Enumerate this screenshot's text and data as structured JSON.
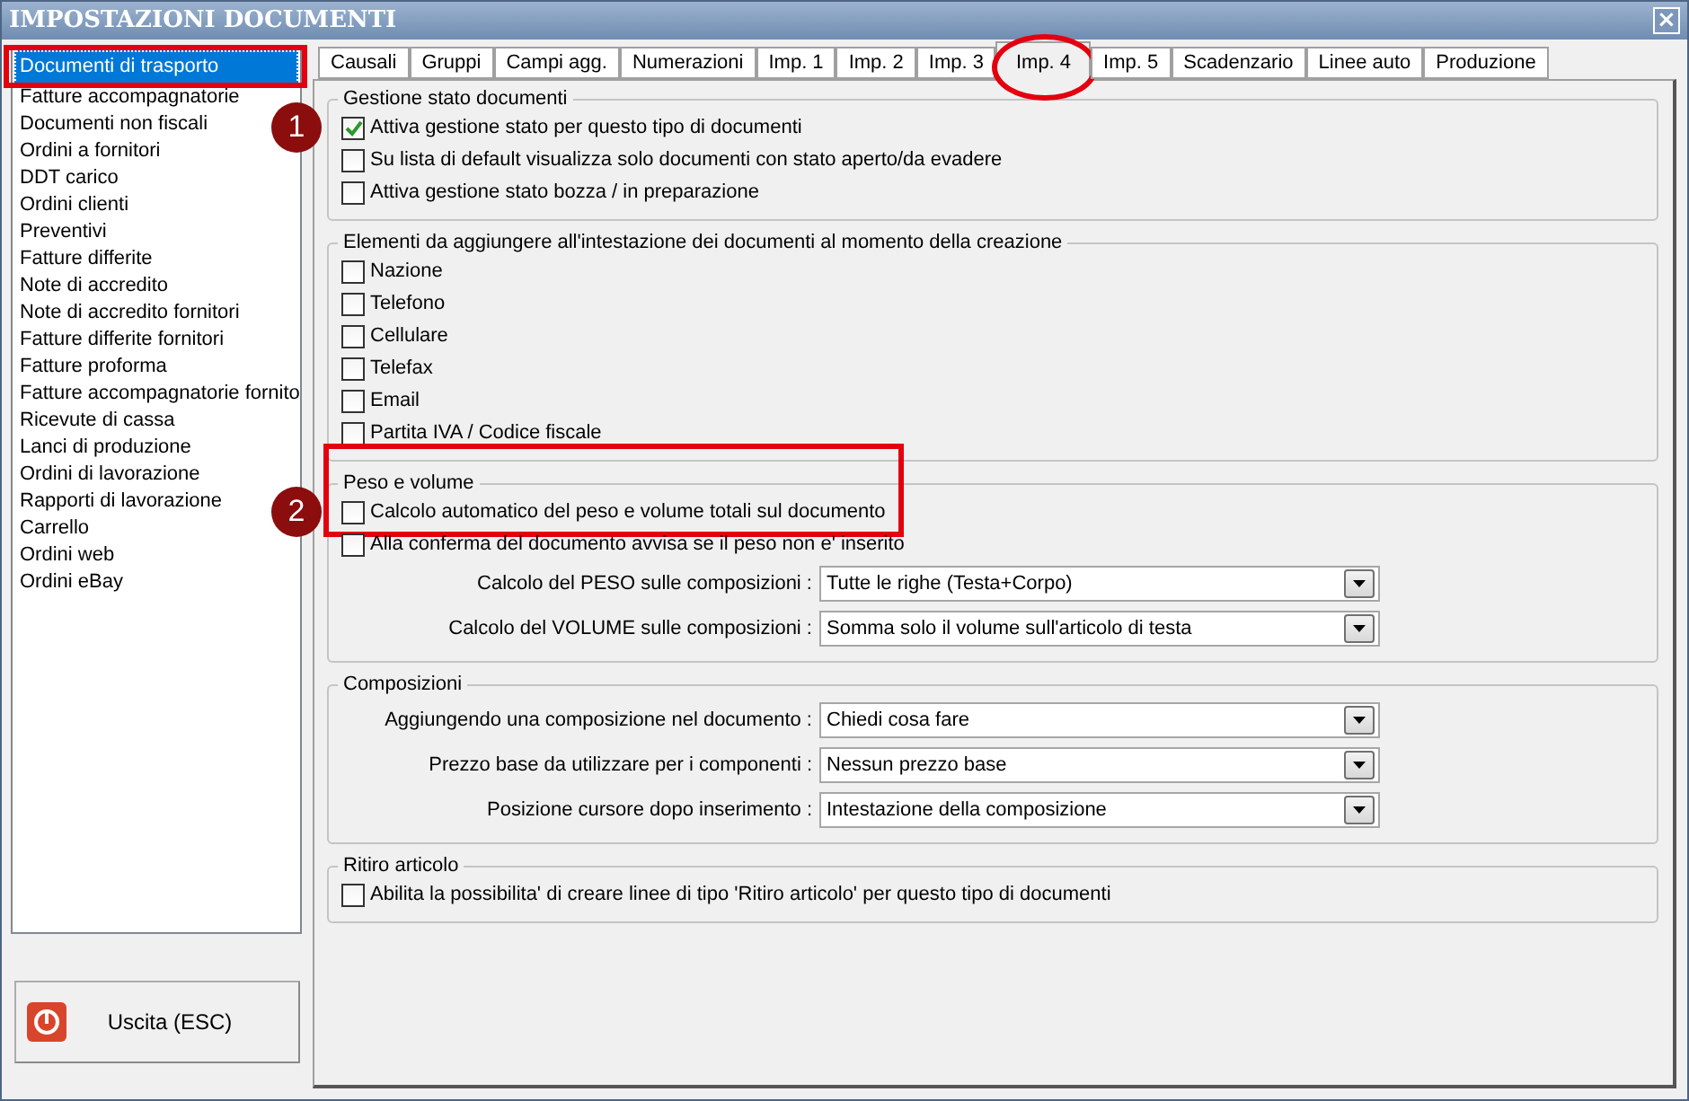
{
  "window": {
    "title": "IMPOSTAZIONI DOCUMENTI",
    "close": "×"
  },
  "sidebar": {
    "items": [
      {
        "label": "Documenti di trasporto",
        "selected": true,
        "highlighted": true
      },
      {
        "label": "Fatture accompagnatorie",
        "selected": false
      },
      {
        "label": "Documenti non fiscali",
        "selected": false
      },
      {
        "label": "Ordini a fornitori",
        "selected": false
      },
      {
        "label": "DDT carico",
        "selected": false
      },
      {
        "label": "Ordini clienti",
        "selected": false
      },
      {
        "label": "Preventivi",
        "selected": false
      },
      {
        "label": "Fatture differite",
        "selected": false
      },
      {
        "label": "Note di accredito",
        "selected": false
      },
      {
        "label": "Note di accredito fornitori",
        "selected": false
      },
      {
        "label": "Fatture differite fornitori",
        "selected": false
      },
      {
        "label": "Fatture proforma",
        "selected": false
      },
      {
        "label": "Fatture accompagnatorie fornito",
        "selected": false
      },
      {
        "label": "Ricevute di cassa",
        "selected": false
      },
      {
        "label": "Lanci di produzione",
        "selected": false
      },
      {
        "label": "Ordini di lavorazione",
        "selected": false
      },
      {
        "label": "Rapporti di lavorazione",
        "selected": false
      },
      {
        "label": "Carrello",
        "selected": false
      },
      {
        "label": "Ordini web",
        "selected": false
      },
      {
        "label": "Ordini eBay",
        "selected": false
      }
    ]
  },
  "exit_button": {
    "label": "Uscita (ESC)"
  },
  "tabs": [
    {
      "label": "Causali",
      "selected": false
    },
    {
      "label": "Gruppi",
      "selected": false
    },
    {
      "label": "Campi agg.",
      "selected": false
    },
    {
      "label": "Numerazioni",
      "selected": false
    },
    {
      "label": "Imp. 1",
      "selected": false
    },
    {
      "label": "Imp. 2",
      "selected": false
    },
    {
      "label": "Imp. 3",
      "selected": false
    },
    {
      "label": "Imp. 4",
      "selected": true,
      "circled": true
    },
    {
      "label": "Imp. 5",
      "selected": false
    },
    {
      "label": "Scadenzario",
      "selected": false
    },
    {
      "label": "Linee auto",
      "selected": false
    },
    {
      "label": "Produzione",
      "selected": false
    }
  ],
  "sections": [
    {
      "title": "Gestione stato documenti",
      "callout": "1",
      "fields": [
        {
          "kind": "checkbox",
          "label": "Attiva gestione stato per questo tipo di documenti",
          "checked": true
        },
        {
          "kind": "checkbox",
          "label": "Su lista di default visualizza solo documenti con stato aperto/da evadere",
          "checked": false
        },
        {
          "kind": "checkbox",
          "label": "Attiva gestione stato bozza / in preparazione",
          "checked": false
        }
      ]
    },
    {
      "title": "Elementi da aggiungere all'intestazione dei documenti al momento della creazione",
      "fields": [
        {
          "kind": "checkbox",
          "label": "Nazione",
          "checked": false
        },
        {
          "kind": "checkbox",
          "label": "Telefono",
          "checked": false
        },
        {
          "kind": "checkbox",
          "label": "Cellulare",
          "checked": false
        },
        {
          "kind": "checkbox",
          "label": "Telefax",
          "checked": false
        },
        {
          "kind": "checkbox",
          "label": "Email",
          "checked": false
        },
        {
          "kind": "checkbox",
          "label": "Partita IVA / Codice fiscale",
          "checked": false
        }
      ]
    },
    {
      "title": "Peso e volume",
      "callout": "2",
      "fields": [
        {
          "kind": "checkbox",
          "label": "Calcolo automatico del peso e volume totali sul documento",
          "checked": false,
          "highlighted": true
        },
        {
          "kind": "checkbox",
          "label": "Alla conferma del documento avvisa se il peso non e' inserito",
          "checked": false
        },
        {
          "kind": "select",
          "label": "Calcolo del PESO sulle composizioni :",
          "value": "Tutte le righe (Testa+Corpo)"
        },
        {
          "kind": "select",
          "label": "Calcolo del VOLUME sulle composizioni :",
          "value": "Somma solo il volume sull'articolo di testa"
        }
      ]
    },
    {
      "title": "Composizioni",
      "fields": [
        {
          "kind": "select",
          "label": "Aggiungendo una composizione nel documento :",
          "value": "Chiedi cosa fare"
        },
        {
          "kind": "select",
          "label": "Prezzo base da utilizzare per i componenti :",
          "value": "Nessun prezzo base"
        },
        {
          "kind": "select",
          "label": "Posizione cursore dopo inserimento :",
          "value": "Intestazione della composizione"
        }
      ]
    },
    {
      "title": "Ritiro articolo",
      "fields": [
        {
          "kind": "checkbox",
          "label": "Abilita la possibilita' di creare linee di tipo 'Ritiro articolo' per questo tipo di documenti",
          "checked": false
        }
      ]
    }
  ]
}
